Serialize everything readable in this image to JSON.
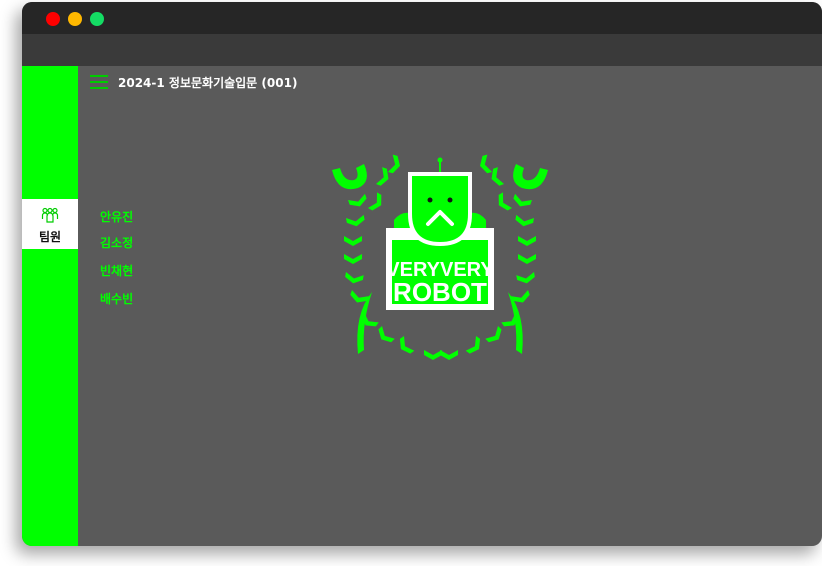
{
  "window": {
    "controls": [
      "close",
      "minimize",
      "maximize"
    ]
  },
  "header": {
    "title": "2024-1 정보문화기술입문 (001)"
  },
  "sidebar": {
    "items": [
      {
        "label": "팀원",
        "icon": "team-icon",
        "active": true
      }
    ]
  },
  "members": [
    "안유진",
    "김소정",
    "빈채현",
    "배수빈"
  ],
  "logo": {
    "line1": "VERYVERY",
    "line2": "ROBOT"
  },
  "colors": {
    "accent": "#00ff00",
    "background": "#5a5a5a",
    "toolbar": "#3a3a3a",
    "titlebar": "#262626"
  }
}
